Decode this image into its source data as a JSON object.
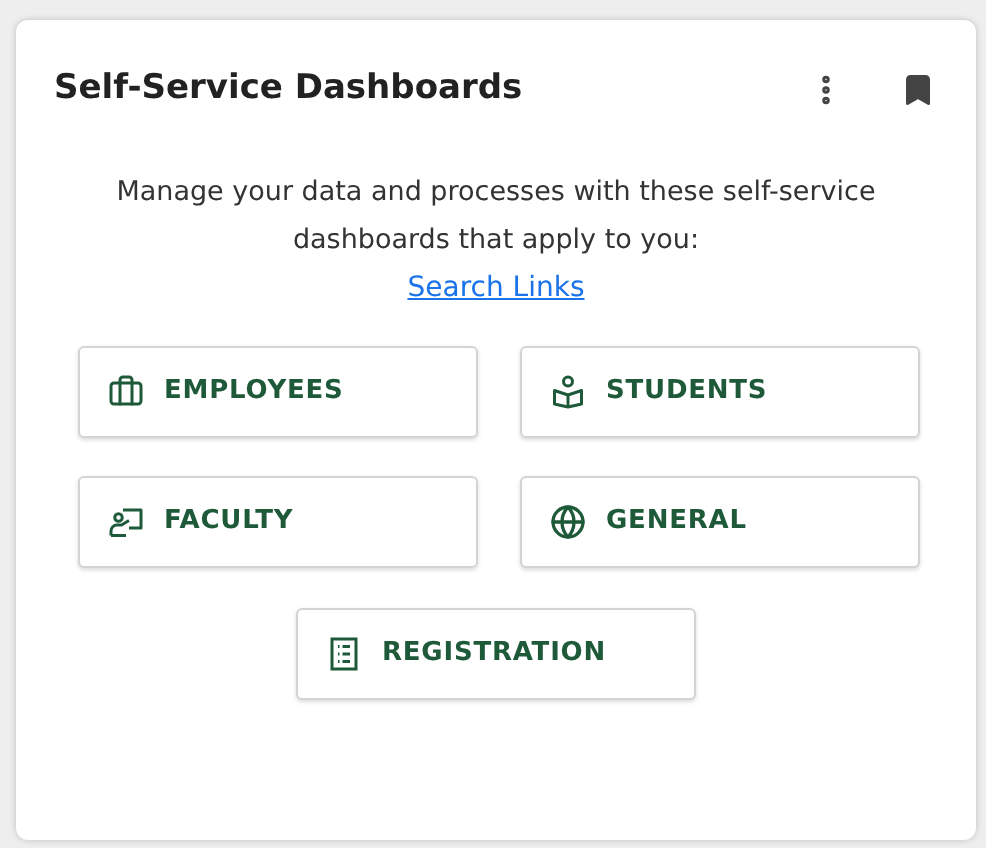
{
  "card": {
    "title": "Self-Service Dashboards",
    "description": "Manage your data and processes with these self-service dashboards that apply to you:",
    "link": "Search Links"
  },
  "buttons": [
    {
      "label": "EMPLOYEES",
      "kind": "briefcase"
    },
    {
      "label": "STUDENTS",
      "kind": "reader"
    },
    {
      "label": "FACULTY",
      "kind": "presenter"
    },
    {
      "label": "GENERAL",
      "kind": "globe"
    },
    {
      "label": "REGISTRATION",
      "kind": "list"
    }
  ]
}
